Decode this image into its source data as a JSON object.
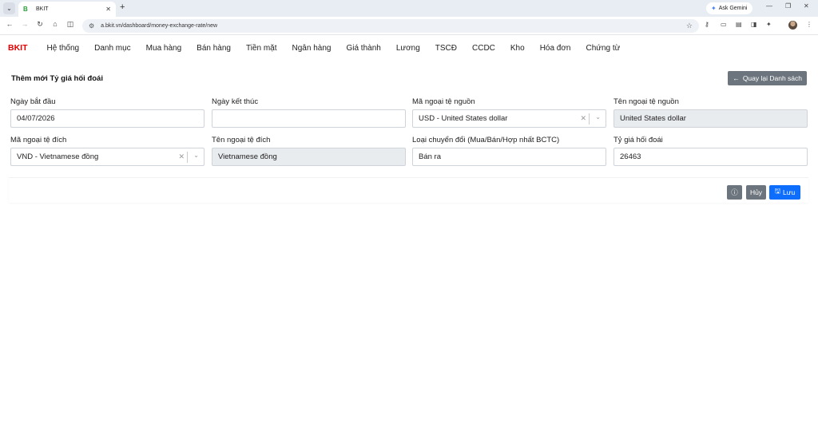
{
  "browser": {
    "tab_title": "BKIT",
    "tab_favicon": "B",
    "url": "a.bkit.vn/dashboard/money-exchange-rate/new",
    "gemini_label": "Ask Gemini"
  },
  "app": {
    "brand": "BKIT",
    "brand_color": "#e10000",
    "menu": [
      "Hệ thống",
      "Danh mục",
      "Mua hàng",
      "Bán hàng",
      "Tiền mặt",
      "Ngân hàng",
      "Giá thành",
      "Lương",
      "TSCĐ",
      "CCDC",
      "Kho",
      "Hóa đơn",
      "Chứng từ"
    ]
  },
  "page": {
    "title": "Thêm mới Tỷ giá hối đoái",
    "back_label": "Quay lại Danh sách"
  },
  "form": {
    "start_date": {
      "label": "Ngày bắt đầu",
      "value": "04/07/2026"
    },
    "end_date": {
      "label": "Ngày kết thúc",
      "value": ""
    },
    "source_currency_code": {
      "label": "Mã ngoại tệ nguồn",
      "value": "USD - United States dollar"
    },
    "source_currency_name": {
      "label": "Tên ngoại tệ nguồn",
      "value": "United States dollar"
    },
    "target_currency_code": {
      "label": "Mã ngoại tệ đích",
      "value": "VND - Vietnamese đồng"
    },
    "target_currency_name": {
      "label": "Tên ngoại tệ đích",
      "value": "Vietnamese đồng"
    },
    "conversion_type": {
      "label": "Loại chuyển đổi (Mua/Bán/Hợp nhất BCTC)",
      "value": "Bán ra"
    },
    "exchange_rate": {
      "label": "Tỷ giá hối đoái",
      "value": "26463"
    }
  },
  "actions": {
    "cancel_label": "Hủy",
    "save_label": "Lưu",
    "save_color": "#0d6efd",
    "secondary_color": "#6c757d"
  }
}
